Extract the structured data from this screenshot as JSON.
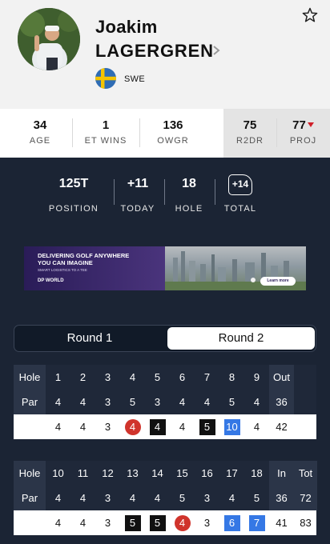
{
  "player": {
    "first_name": "Joakim",
    "last_name": "LAGERGREN",
    "country": "SWE"
  },
  "stats": [
    {
      "value": "34",
      "label": "AGE"
    },
    {
      "value": "1",
      "label": "ET WINS"
    },
    {
      "value": "136",
      "label": "OWGR"
    },
    {
      "value": "75",
      "label": "R2DR"
    },
    {
      "value": "77",
      "label": "PROJ"
    }
  ],
  "summary": [
    {
      "value": "125T",
      "label": "POSITION"
    },
    {
      "value": "+11",
      "label": "TODAY"
    },
    {
      "value": "18",
      "label": "HOLE"
    },
    {
      "value": "+14",
      "label": "TOTAL"
    }
  ],
  "ad": {
    "headline_1": "DELIVERING GOLF ANYWHERE",
    "headline_2": "YOU CAN IMAGINE",
    "subtext": "SMART LOGISTICS TO A TEE",
    "logo": "DP WORLD",
    "button": "Learn more"
  },
  "rounds": {
    "round1": "Round 1",
    "round2": "Round 2",
    "selected": "Round 2"
  },
  "front_nine": {
    "hole_label": "Hole",
    "par_label": "Par",
    "holes": [
      "1",
      "2",
      "3",
      "4",
      "5",
      "6",
      "7",
      "8",
      "9"
    ],
    "out_label": "Out",
    "pars": [
      "4",
      "4",
      "3",
      "5",
      "3",
      "4",
      "4",
      "5",
      "4"
    ],
    "par_out": "36",
    "scores": [
      "4",
      "4",
      "3",
      "4",
      "4",
      "4",
      "5",
      "10",
      "4"
    ],
    "score_types": [
      "",
      "",
      "",
      "birdie",
      "bogey",
      "",
      "bogey",
      "dbl",
      ""
    ],
    "score_out": "42"
  },
  "back_nine": {
    "hole_label": "Hole",
    "par_label": "Par",
    "holes": [
      "10",
      "11",
      "12",
      "13",
      "14",
      "15",
      "16",
      "17",
      "18"
    ],
    "in_label": "In",
    "tot_label": "Tot",
    "pars": [
      "4",
      "4",
      "3",
      "4",
      "4",
      "5",
      "3",
      "4",
      "5"
    ],
    "par_in": "36",
    "par_tot": "72",
    "scores": [
      "4",
      "4",
      "3",
      "5",
      "5",
      "4",
      "3",
      "6",
      "7"
    ],
    "score_types": [
      "",
      "",
      "",
      "bogey",
      "bogey",
      "birdie",
      "",
      "dbl",
      "dbl"
    ],
    "score_in": "41",
    "score_tot": "83"
  },
  "colors": {
    "birdie": "#d0342c",
    "bogey": "#111111",
    "double_bogey": "#3578e5",
    "projection_arrow": "#d0202a"
  }
}
